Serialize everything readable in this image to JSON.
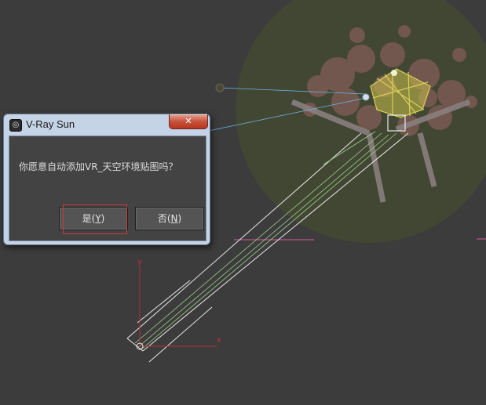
{
  "dialog": {
    "title": "V-Ray Sun",
    "title_icon": "vray-logo-icon",
    "close_icon": "close-icon",
    "close_glyph": "✕",
    "message": "你愿意自动添加VR_天空环境贴图吗？",
    "buttons": {
      "yes_prefix": "是(",
      "yes_key": "Y",
      "yes_suffix": ")",
      "no_prefix": "否(",
      "no_key": "N",
      "no_suffix": ")"
    }
  },
  "viewport": {
    "axis_x_label": "x",
    "axis_y_label": "y",
    "colors": {
      "background": "#3c3c3c",
      "ground": "#424733",
      "trees": "#7a5a52",
      "sun_target": "#d8cf5a",
      "beam": "#9fd08c",
      "link": "#6fb7e8",
      "axis": "#b0303a",
      "highlight": "#d0383a"
    }
  }
}
